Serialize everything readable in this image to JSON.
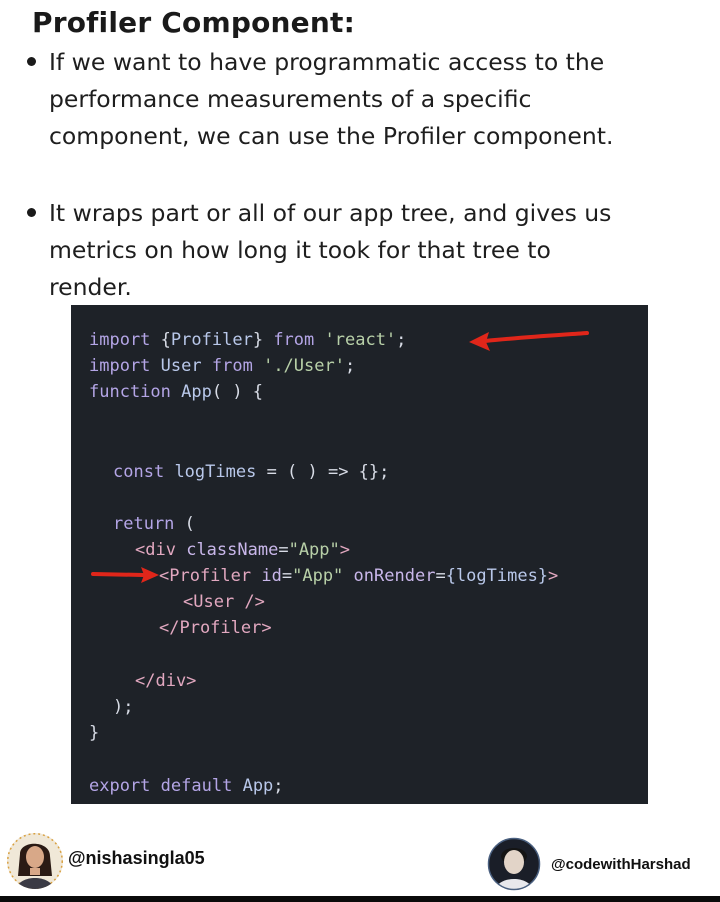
{
  "title": "Profiler Component:",
  "bullets": [
    {
      "lines": [
        "If we want to have programmatic access to the",
        "performance measurements of a specific",
        "component, we can use the Profiler component."
      ]
    },
    {
      "lines": [
        "It wraps part or all of our app tree, and gives us",
        "metrics on how long it took for that tree to",
        "render."
      ]
    }
  ],
  "code": {
    "import_profiler": {
      "kw1": "import",
      "braces_open": "{",
      "name": "Profiler",
      "braces_close": "}",
      "kw2": "from",
      "source": "'react'",
      "semi": ";"
    },
    "import_user": {
      "kw1": "import",
      "name": "User",
      "kw2": "from",
      "source": "'./User'",
      "semi": ";"
    },
    "function_decl": {
      "kw": "function",
      "name": "App",
      "rest": "( ) {"
    },
    "const_line": {
      "kw": "const",
      "name": "logTimes",
      "rest": " = ( ) => {};"
    },
    "return_line": {
      "kw": "return",
      "rest": " ("
    },
    "div_open": {
      "tag_open": "<div",
      "attr": "className",
      "eq": "=",
      "value": "\"App\"",
      "close": ">"
    },
    "profiler_open": {
      "tag_open": "<Profiler",
      "attr1": "id",
      "eq1": "=",
      "value1": "\"App\"",
      "attr2": "onRender",
      "eq2": "=",
      "value2": "{logTimes}",
      "close": ">"
    },
    "user_tag": "<User />",
    "profiler_close": "</Profiler>",
    "div_close": "</div>",
    "paren_close": ");",
    "brace_close": "}",
    "export_line": {
      "kw1": "export",
      "kw2": "default",
      "name": "App",
      "semi": ";"
    }
  },
  "footer": {
    "left_handle": "@nishasingla05",
    "right_handle": "@codewithHarshad"
  },
  "colors": {
    "code_bg": "#1e2228",
    "arrow": "#e0261a"
  }
}
